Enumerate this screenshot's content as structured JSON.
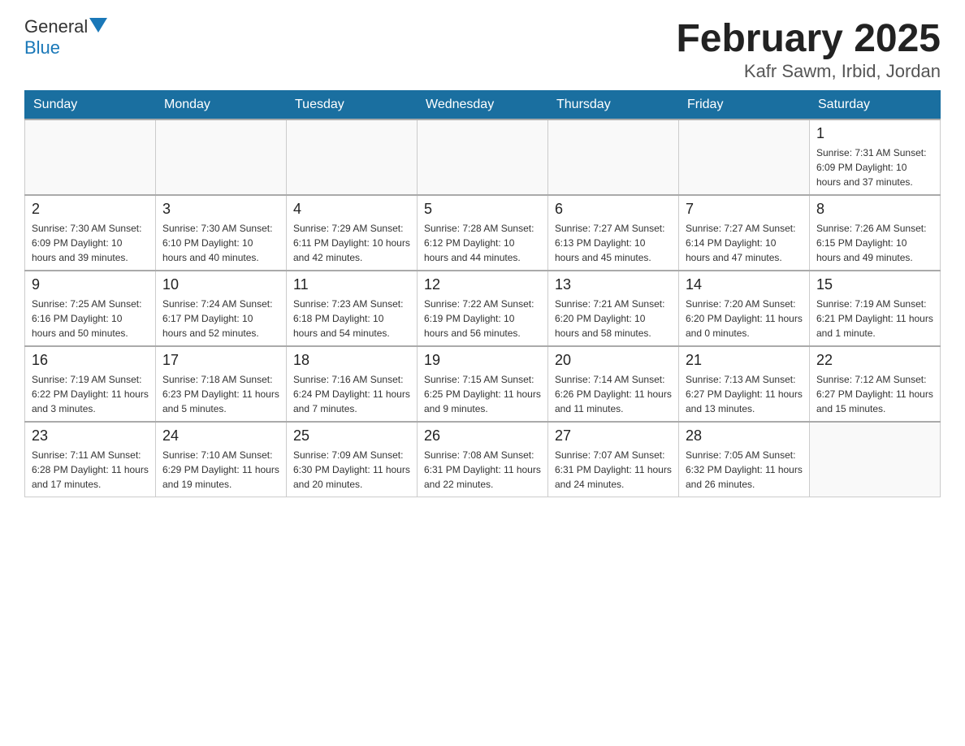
{
  "header": {
    "logo": {
      "text_general": "General",
      "text_blue": "Blue",
      "arrow_alt": "logo arrow"
    },
    "title": "February 2025",
    "subtitle": "Kafr Sawm, Irbid, Jordan"
  },
  "days_of_week": [
    "Sunday",
    "Monday",
    "Tuesday",
    "Wednesday",
    "Thursday",
    "Friday",
    "Saturday"
  ],
  "weeks": [
    [
      {
        "date": "",
        "info": ""
      },
      {
        "date": "",
        "info": ""
      },
      {
        "date": "",
        "info": ""
      },
      {
        "date": "",
        "info": ""
      },
      {
        "date": "",
        "info": ""
      },
      {
        "date": "",
        "info": ""
      },
      {
        "date": "1",
        "info": "Sunrise: 7:31 AM\nSunset: 6:09 PM\nDaylight: 10 hours and 37 minutes."
      }
    ],
    [
      {
        "date": "2",
        "info": "Sunrise: 7:30 AM\nSunset: 6:09 PM\nDaylight: 10 hours and 39 minutes."
      },
      {
        "date": "3",
        "info": "Sunrise: 7:30 AM\nSunset: 6:10 PM\nDaylight: 10 hours and 40 minutes."
      },
      {
        "date": "4",
        "info": "Sunrise: 7:29 AM\nSunset: 6:11 PM\nDaylight: 10 hours and 42 minutes."
      },
      {
        "date": "5",
        "info": "Sunrise: 7:28 AM\nSunset: 6:12 PM\nDaylight: 10 hours and 44 minutes."
      },
      {
        "date": "6",
        "info": "Sunrise: 7:27 AM\nSunset: 6:13 PM\nDaylight: 10 hours and 45 minutes."
      },
      {
        "date": "7",
        "info": "Sunrise: 7:27 AM\nSunset: 6:14 PM\nDaylight: 10 hours and 47 minutes."
      },
      {
        "date": "8",
        "info": "Sunrise: 7:26 AM\nSunset: 6:15 PM\nDaylight: 10 hours and 49 minutes."
      }
    ],
    [
      {
        "date": "9",
        "info": "Sunrise: 7:25 AM\nSunset: 6:16 PM\nDaylight: 10 hours and 50 minutes."
      },
      {
        "date": "10",
        "info": "Sunrise: 7:24 AM\nSunset: 6:17 PM\nDaylight: 10 hours and 52 minutes."
      },
      {
        "date": "11",
        "info": "Sunrise: 7:23 AM\nSunset: 6:18 PM\nDaylight: 10 hours and 54 minutes."
      },
      {
        "date": "12",
        "info": "Sunrise: 7:22 AM\nSunset: 6:19 PM\nDaylight: 10 hours and 56 minutes."
      },
      {
        "date": "13",
        "info": "Sunrise: 7:21 AM\nSunset: 6:20 PM\nDaylight: 10 hours and 58 minutes."
      },
      {
        "date": "14",
        "info": "Sunrise: 7:20 AM\nSunset: 6:20 PM\nDaylight: 11 hours and 0 minutes."
      },
      {
        "date": "15",
        "info": "Sunrise: 7:19 AM\nSunset: 6:21 PM\nDaylight: 11 hours and 1 minute."
      }
    ],
    [
      {
        "date": "16",
        "info": "Sunrise: 7:19 AM\nSunset: 6:22 PM\nDaylight: 11 hours and 3 minutes."
      },
      {
        "date": "17",
        "info": "Sunrise: 7:18 AM\nSunset: 6:23 PM\nDaylight: 11 hours and 5 minutes."
      },
      {
        "date": "18",
        "info": "Sunrise: 7:16 AM\nSunset: 6:24 PM\nDaylight: 11 hours and 7 minutes."
      },
      {
        "date": "19",
        "info": "Sunrise: 7:15 AM\nSunset: 6:25 PM\nDaylight: 11 hours and 9 minutes."
      },
      {
        "date": "20",
        "info": "Sunrise: 7:14 AM\nSunset: 6:26 PM\nDaylight: 11 hours and 11 minutes."
      },
      {
        "date": "21",
        "info": "Sunrise: 7:13 AM\nSunset: 6:27 PM\nDaylight: 11 hours and 13 minutes."
      },
      {
        "date": "22",
        "info": "Sunrise: 7:12 AM\nSunset: 6:27 PM\nDaylight: 11 hours and 15 minutes."
      }
    ],
    [
      {
        "date": "23",
        "info": "Sunrise: 7:11 AM\nSunset: 6:28 PM\nDaylight: 11 hours and 17 minutes."
      },
      {
        "date": "24",
        "info": "Sunrise: 7:10 AM\nSunset: 6:29 PM\nDaylight: 11 hours and 19 minutes."
      },
      {
        "date": "25",
        "info": "Sunrise: 7:09 AM\nSunset: 6:30 PM\nDaylight: 11 hours and 20 minutes."
      },
      {
        "date": "26",
        "info": "Sunrise: 7:08 AM\nSunset: 6:31 PM\nDaylight: 11 hours and 22 minutes."
      },
      {
        "date": "27",
        "info": "Sunrise: 7:07 AM\nSunset: 6:31 PM\nDaylight: 11 hours and 24 minutes."
      },
      {
        "date": "28",
        "info": "Sunrise: 7:05 AM\nSunset: 6:32 PM\nDaylight: 11 hours and 26 minutes."
      },
      {
        "date": "",
        "info": ""
      }
    ]
  ]
}
